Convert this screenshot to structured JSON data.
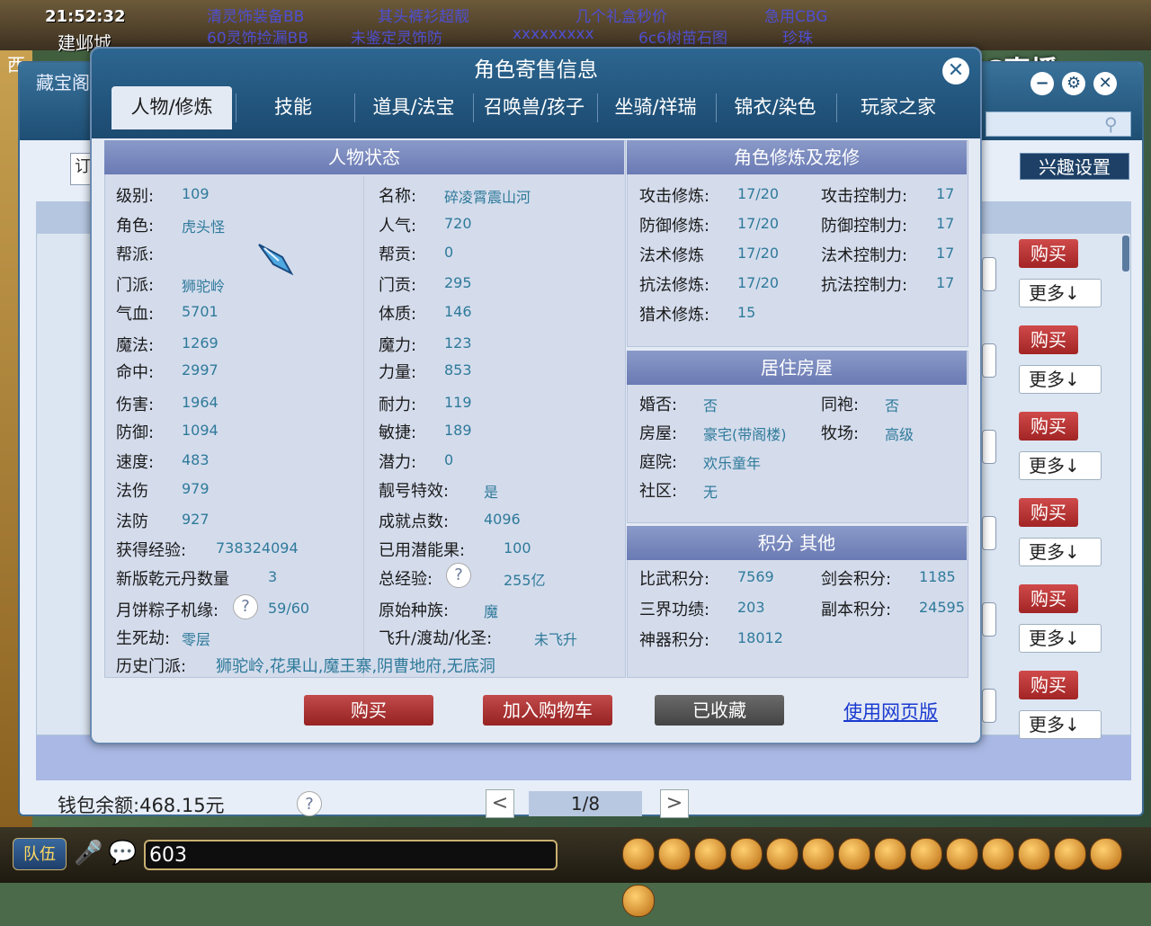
{
  "game": {
    "clock": "21:52:32",
    "location": "建邺城",
    "news": [
      "清灵饰装备BB",
      "其头裤衫超靓",
      "几个礼盒秒价",
      "急用CBG",
      "60灵饰捡漏BB",
      "未鉴定灵饰防",
      "xxxxxxxxx",
      "6c6树苗石图",
      "珍珠"
    ],
    "left_strip": "西",
    "cc_logo": "CC直播"
  },
  "bg_window": {
    "title": "藏宝阁",
    "controls": [
      "−",
      "⚙",
      "✕"
    ],
    "left_tab_char": "订",
    "interest_button": "兴趣设置",
    "row_buttons": {
      "buy": "购买",
      "more": "更多↓"
    },
    "row_count": 6,
    "wallet_label": "钱包余额:",
    "wallet_value": "468.15元",
    "page_indicator": "1/8",
    "prev": "<",
    "next": ">"
  },
  "modal": {
    "title": "角色寄售信息",
    "close": "✕",
    "tabs": [
      "人物/修炼",
      "技能",
      "道具/法宝",
      "召唤兽/孩子",
      "坐骑/祥瑞",
      "锦衣/染色",
      "玩家之家"
    ],
    "active_tab": 0,
    "status_panel": {
      "title": "人物状态",
      "left_col": [
        {
          "label": "级别:",
          "value": "109"
        },
        {
          "label": "角色:",
          "value": "虎头怪"
        },
        {
          "label": "帮派:",
          "value": ""
        },
        {
          "label": "门派:",
          "value": "狮驼岭"
        },
        {
          "label": "气血:",
          "value": "5701"
        },
        {
          "label": "魔法:",
          "value": "1269"
        },
        {
          "label": "命中:",
          "value": "2997"
        },
        {
          "label": "伤害:",
          "value": "1964"
        },
        {
          "label": "防御:",
          "value": "1094"
        },
        {
          "label": "速度:",
          "value": "483"
        },
        {
          "label": "法伤",
          "value": "979"
        },
        {
          "label": "法防",
          "value": "927"
        },
        {
          "label": "获得经验:",
          "value": "738324094"
        },
        {
          "label": "新版乾元丹数量",
          "value": "3"
        },
        {
          "label": "月饼粽子机缘:",
          "value": "59/60"
        },
        {
          "label": "生死劫:",
          "value": "零层"
        }
      ],
      "right_col": [
        {
          "label": "名称:",
          "value": "碎凌霄震山河"
        },
        {
          "label": "人气:",
          "value": "720"
        },
        {
          "label": "帮贡:",
          "value": "0"
        },
        {
          "label": "门贡:",
          "value": "295"
        },
        {
          "label": "体质:",
          "value": "146"
        },
        {
          "label": "魔力:",
          "value": "123"
        },
        {
          "label": "力量:",
          "value": "853"
        },
        {
          "label": "耐力:",
          "value": "119"
        },
        {
          "label": "敏捷:",
          "value": "189"
        },
        {
          "label": "潜力:",
          "value": "0"
        },
        {
          "label": "靓号特效:",
          "value": "是"
        },
        {
          "label": "成就点数:",
          "value": "4096"
        },
        {
          "label": "已用潜能果:",
          "value": "100"
        },
        {
          "label": "总经验:",
          "value": "255亿"
        },
        {
          "label": "原始种族:",
          "value": "魔"
        },
        {
          "label": "飞升/渡劫/化圣:",
          "value": "未飞升"
        }
      ],
      "history_label": "历史门派:",
      "history_value": "狮驼岭,花果山,魔王寨,阴曹地府,无底洞",
      "help": "?"
    },
    "cultivation_panel": {
      "title": "角色修炼及宠修",
      "rows": [
        {
          "l1": "攻击修炼:",
          "v1": "17/20",
          "l2": "攻击控制力:",
          "v2": "17"
        },
        {
          "l1": "防御修炼:",
          "v1": "17/20",
          "l2": "防御控制力:",
          "v2": "17"
        },
        {
          "l1": "法术修炼",
          "v1": "17/20",
          "l2": "法术控制力:",
          "v2": "17"
        },
        {
          "l1": "抗法修炼:",
          "v1": "17/20",
          "l2": "抗法控制力:",
          "v2": "17"
        },
        {
          "l1": "猎术修炼:",
          "v1": "15",
          "l2": "",
          "v2": ""
        }
      ]
    },
    "house_panel": {
      "title": "居住房屋",
      "rows": [
        {
          "l1": "婚否:",
          "v1": "否",
          "l2": "同袍:",
          "v2": "否"
        },
        {
          "l1": "房屋:",
          "v1": "豪宅(带阁楼)",
          "l2": "牧场:",
          "v2": "高级"
        },
        {
          "l1": "庭院:",
          "v1": "欢乐童年",
          "l2": "",
          "v2": ""
        },
        {
          "l1": "社区:",
          "v1": "无",
          "l2": "",
          "v2": ""
        }
      ]
    },
    "score_panel": {
      "title": "积分 其他",
      "rows": [
        {
          "l1": "比武积分:",
          "v1": "7569",
          "l2": "剑会积分:",
          "v2": "1185"
        },
        {
          "l1": "三界功绩:",
          "v1": "203",
          "l2": "副本积分:",
          "v2": "24595"
        },
        {
          "l1": "神器积分:",
          "v1": "18012",
          "l2": "",
          "v2": ""
        }
      ]
    },
    "buttons": {
      "buy": "购买",
      "cart": "加入购物车",
      "favorited": "已收藏",
      "web": "使用网页版"
    }
  },
  "chat": {
    "team_button": "队伍",
    "input_value": "603"
  },
  "colors": {
    "accent": "#1c4a70",
    "value": "#2f7a9a",
    "buy": "#b03030"
  }
}
